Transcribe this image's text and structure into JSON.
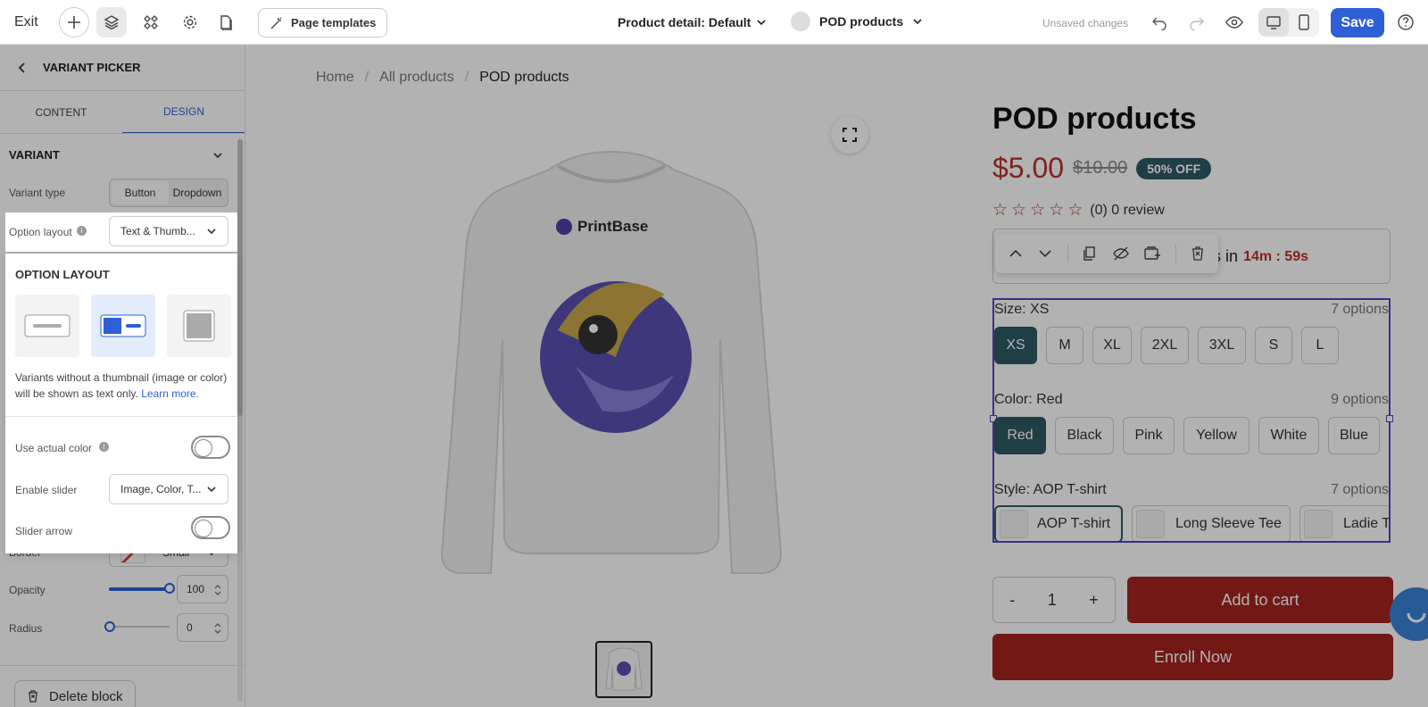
{
  "topbar": {
    "exit_label": "Exit",
    "page_templates_label": "Page templates",
    "page_select_label": "Product detail: Default",
    "product_select_label": "POD products",
    "status_text": "Unsaved changes",
    "save_label": "Save"
  },
  "sidebar": {
    "back_title": "VARIANT PICKER",
    "tabs": [
      "CONTENT",
      "DESIGN"
    ],
    "active_tab": "DESIGN",
    "section_title": "VARIANT",
    "variant_type_label": "Variant type",
    "variant_type_options": [
      "Button",
      "Dropdown"
    ],
    "option_layout_label": "Option layout",
    "option_layout_value": "Text & Thumb...",
    "popup": {
      "title": "OPTION LAYOUT",
      "help_text": "Variants without a thumbnail (image or color) will be shown as text only.",
      "learn_more": "Learn more.",
      "use_actual_color_label": "Use actual color",
      "enable_slider_label": "Enable slider",
      "enable_slider_value": "Image, Color, T...",
      "slider_arrow_label": "Slider arrow"
    },
    "border_label": "Border",
    "border_value": "Small",
    "opacity_label": "Opacity",
    "opacity_value": "100",
    "opacity_level": 1.0,
    "radius_label": "Radius",
    "radius_value": "0",
    "delete_label": "Delete block"
  },
  "breadcrumb": [
    "Home",
    "All products",
    "POD products"
  ],
  "product": {
    "title": "POD products",
    "price": "$5.00",
    "compare_price": "$10.00",
    "discount_badge": "50% OFF",
    "review_text": "(0) 0 review",
    "sale_text": "e ends in",
    "countdown": "14m : 59s",
    "logo_text": "PrintBase",
    "options": [
      {
        "label": "Size: XS",
        "count": "7 options",
        "values": [
          "XS",
          "M",
          "XL",
          "2XL",
          "3XL",
          "S",
          "L"
        ],
        "selected": "XS"
      },
      {
        "label": "Color: Red",
        "count": "9 options",
        "values": [
          "Red",
          "Black",
          "Pink",
          "Yellow",
          "White",
          "Blue"
        ],
        "selected": "Red"
      },
      {
        "label": "Style: AOP T-shirt",
        "count": "7 options",
        "values": [
          "AOP T-shirt",
          "Long Sleeve Tee",
          "Ladie T-"
        ],
        "selected": "AOP T-shirt"
      }
    ],
    "quantity": "1",
    "qty_minus": "-",
    "qty_plus": "+",
    "add_to_cart": "Add to cart",
    "enroll": "Enroll Now"
  },
  "colors": {
    "accent_blue": "#2e5fd6",
    "price_red": "#b8322c",
    "button_red": "#a4231f",
    "badge_teal": "#2f5a63"
  }
}
